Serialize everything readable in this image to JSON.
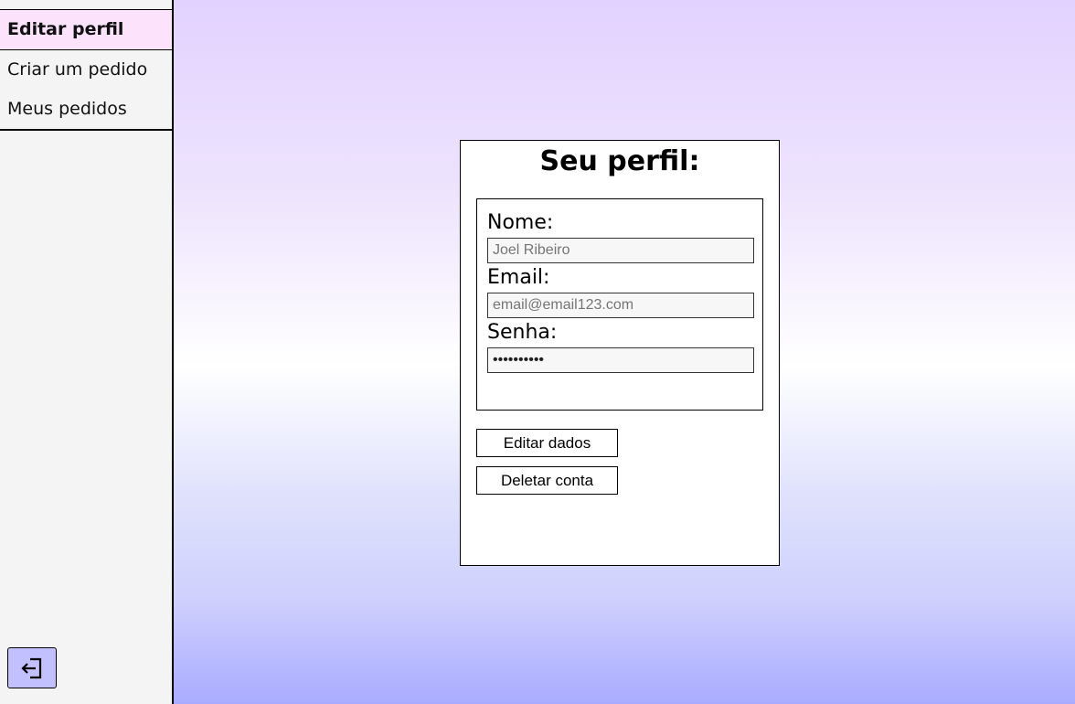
{
  "sidebar": {
    "items": [
      {
        "label": "Editar perfil",
        "active": true
      },
      {
        "label": "Criar um pedido",
        "active": false
      },
      {
        "label": "Meus pedidos",
        "active": false
      }
    ],
    "logout_icon": "logout-icon",
    "logout_color": "#c3c0ff",
    "active_color": "#fde2fb"
  },
  "profile": {
    "title": "Seu perfil:",
    "fields": {
      "name": {
        "label": "Nome:",
        "placeholder": "Joel Ribeiro"
      },
      "email": {
        "label": "Email:",
        "placeholder": "email@email123.com"
      },
      "password": {
        "label": "Senha:",
        "value": "••••••••••"
      }
    },
    "buttons": {
      "edit": "Editar dados",
      "delete": "Deletar conta"
    }
  }
}
